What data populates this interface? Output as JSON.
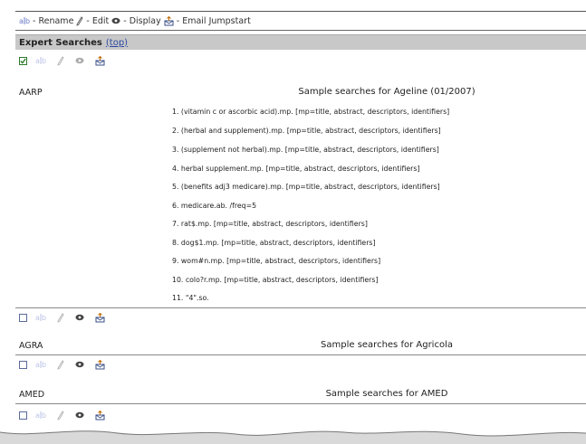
{
  "legend": {
    "items": [
      {
        "icon": "rename-icon",
        "label": "- Rename"
      },
      {
        "icon": "edit-icon",
        "label": "- Edit"
      },
      {
        "icon": "display-icon",
        "label": "- Display"
      },
      {
        "icon": "email-icon",
        "label": "- Email Jumpstart"
      }
    ]
  },
  "section": {
    "title": "Expert Searches",
    "top_link": "(top)"
  },
  "databases": [
    {
      "code": "AARP",
      "title": "Sample searches for Ageline (01/2007)",
      "queries": [
        "1. (vitamin c or ascorbic acid).mp.  [mp=title, abstract, descriptors, identifiers]",
        "2. (herbal and supplement).mp.  [mp=title, abstract, descriptors, identifiers]",
        "3. (supplement not herbal).mp.  [mp=title, abstract, descriptors, identifiers]",
        "4. herbal supplement.mp.  [mp=title, abstract, descriptors, identifiers]",
        "5. (benefits adj3 medicare).mp.  [mp=title, abstract, descriptors, identifiers]",
        "6. medicare.ab. /freq=5",
        "7. rat$.mp.  [mp=title, abstract, descriptors, identifiers]",
        "8. dog$1.mp.  [mp=title, abstract, descriptors, identifiers]",
        "9. wom#n.mp.  [mp=title, abstract, descriptors, identifiers]",
        "10. colo?r.mp.  [mp=title, abstract, descriptors, identifiers]",
        "11. \"4\".so."
      ]
    },
    {
      "code": "AGRA",
      "title": "Sample searches for Agricola",
      "queries": []
    },
    {
      "code": "AMED",
      "title": "Sample searches for AMED",
      "queries": []
    }
  ],
  "colors": {
    "header_bg": "#c8c8c8",
    "link": "#2b4aa0",
    "check": "#2c7a2c"
  }
}
